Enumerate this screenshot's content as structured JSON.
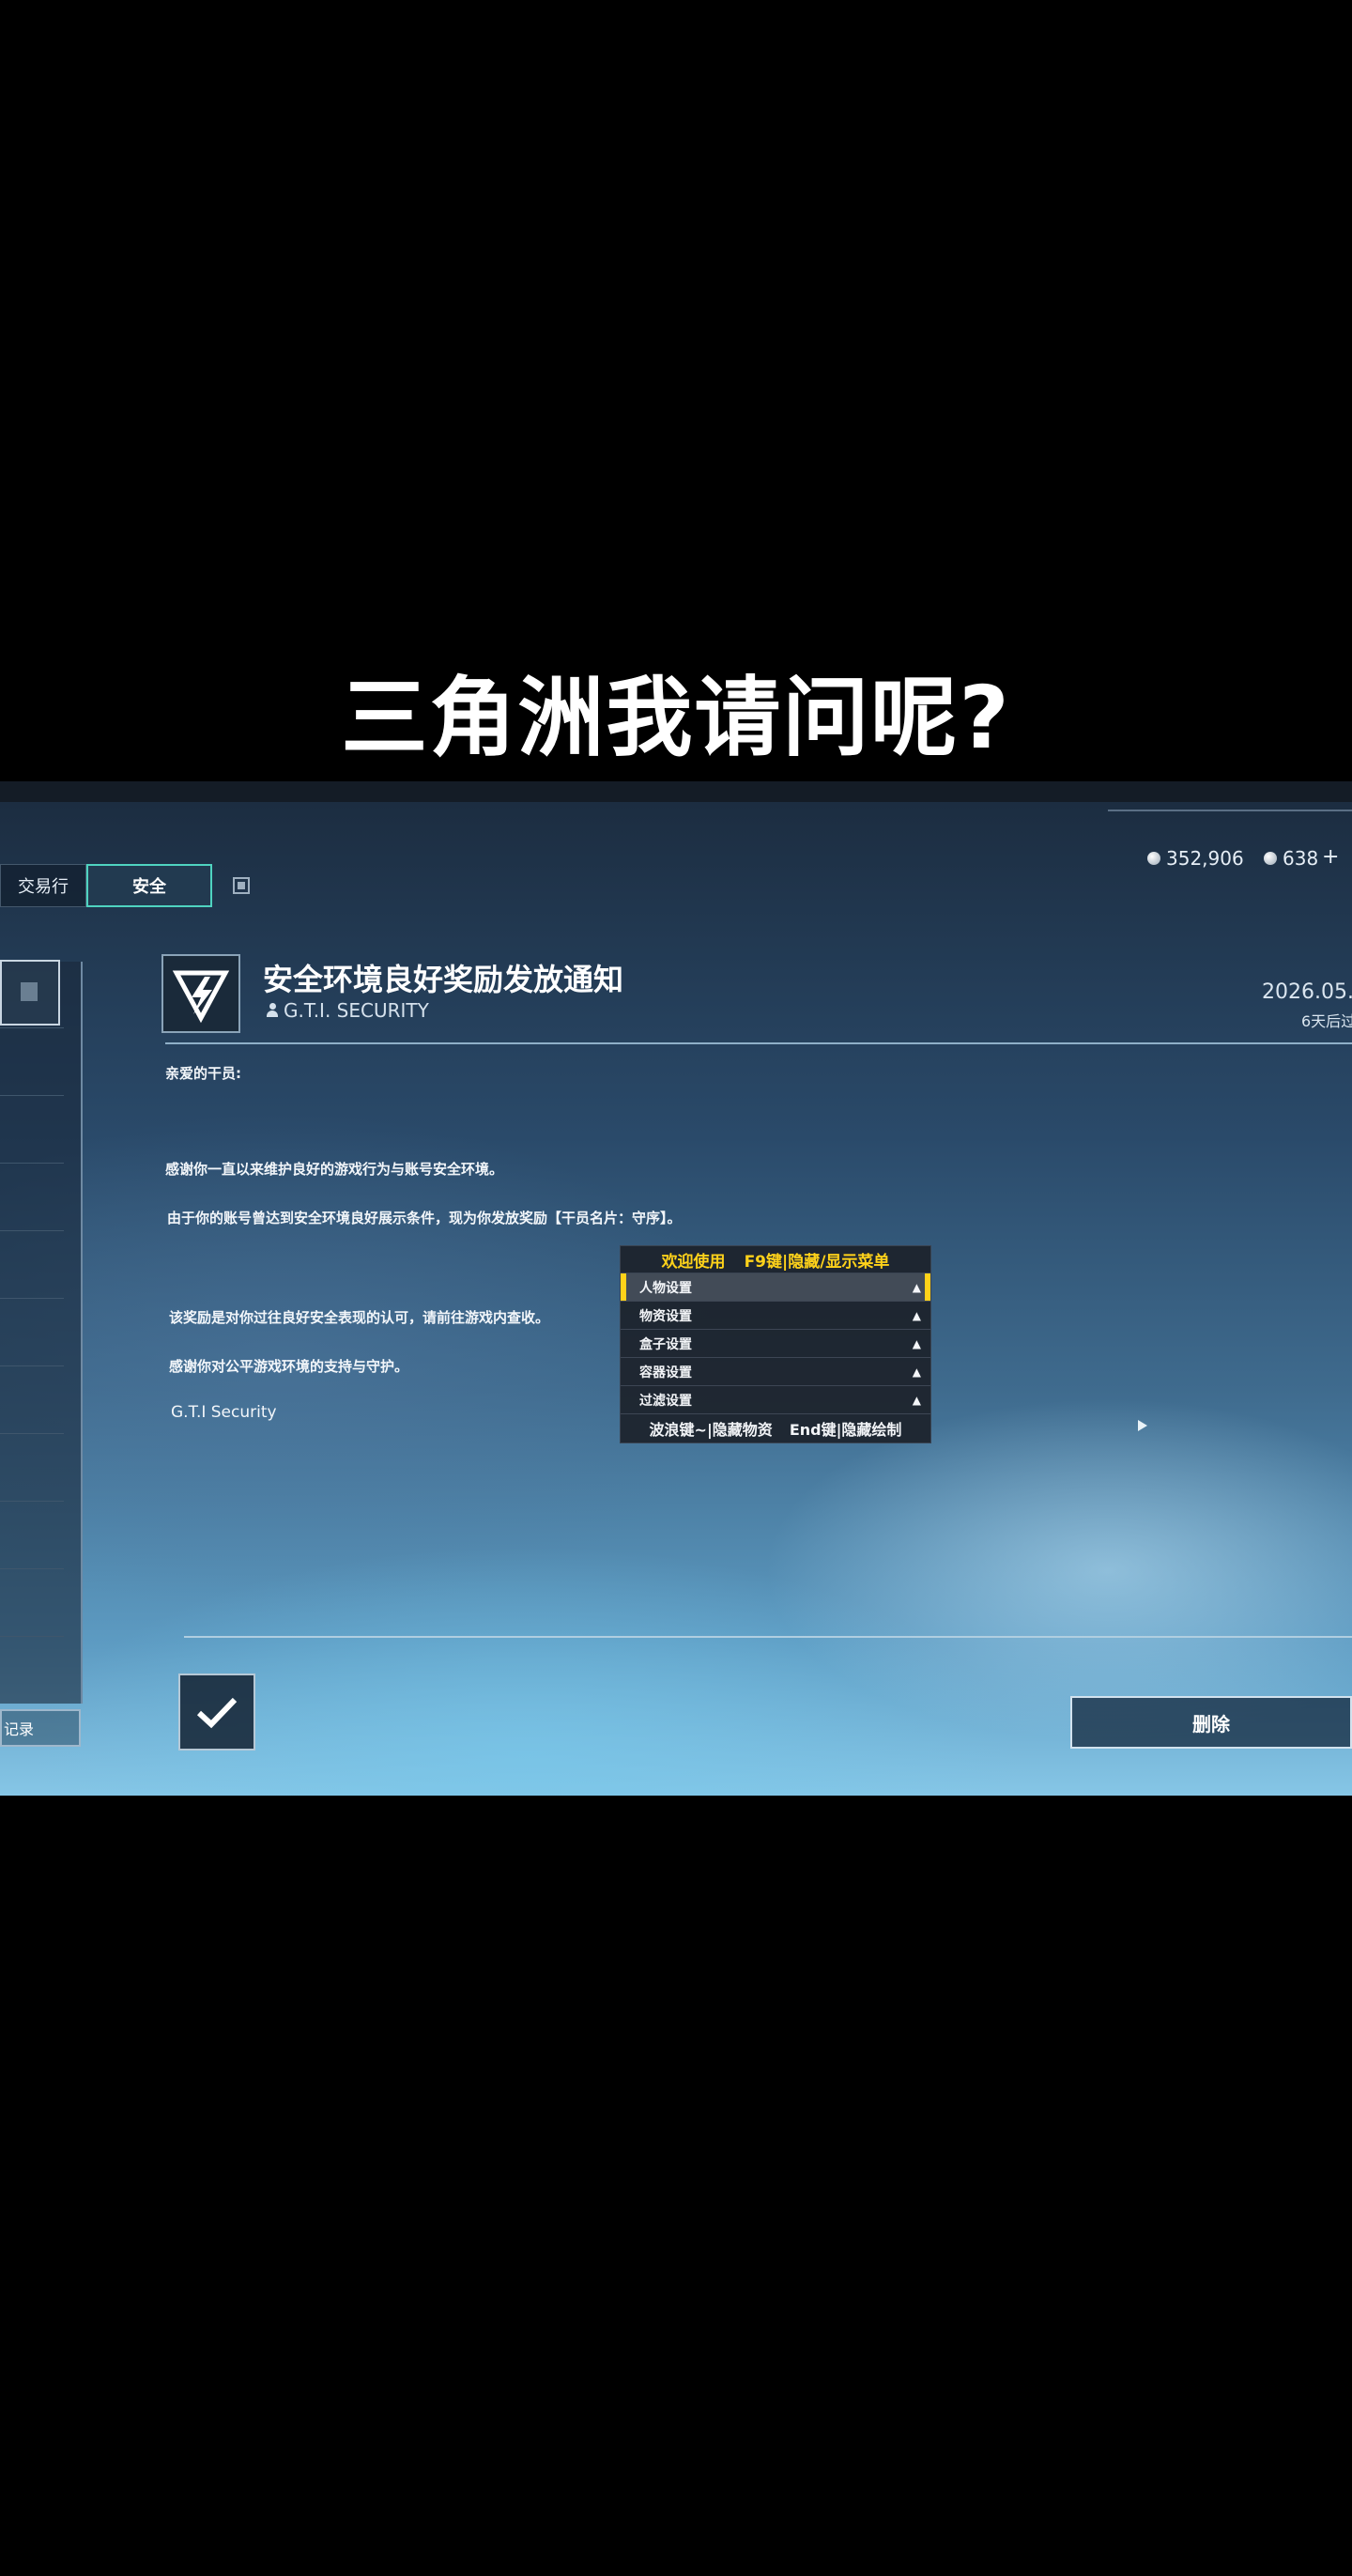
{
  "caption": "三角洲我请问呢?",
  "tabs": {
    "exchange": "交易行",
    "security": "安全"
  },
  "currency": {
    "primary": "352,906",
    "secondary": "638",
    "add_symbol": "+"
  },
  "mail": {
    "title": "安全环境良好奖励发放通知",
    "sender": "G.T.I. SECURITY",
    "date": "2026.05.",
    "expire": "6天后过",
    "greeting": "亲爱的干员:",
    "paragraph1": "感谢你一直以来维护良好的游戏行为与账号安全环境。",
    "paragraph2": "由于你的账号曾达到安全环境良好展示条件，现为你发放奖励【干员名片：守序】。",
    "paragraph3": "该奖励是对你过往良好安全表现的认可，请前往游戏内查收。",
    "paragraph4": "感谢你对公平游戏环境的支持与守护。",
    "signature": "G.T.I Security"
  },
  "overlay_menu": {
    "title_left": "欢迎使用",
    "title_right": "F9键|隐藏/显示菜单",
    "items": [
      {
        "label": "人物设置",
        "caret": "▲"
      },
      {
        "label": "物资设置",
        "caret": "▲"
      },
      {
        "label": "盒子设置",
        "caret": "▲"
      },
      {
        "label": "容器设置",
        "caret": "▲"
      },
      {
        "label": "过滤设置",
        "caret": "▲"
      }
    ],
    "footer_left": "波浪键~|隐藏物资",
    "footer_right": "End键|隐藏绘制"
  },
  "buttons": {
    "delete": "删除",
    "bottom_left": "记录"
  },
  "colors": {
    "accent_teal": "#4fd3c0",
    "menu_yellow": "#ffd21a"
  }
}
